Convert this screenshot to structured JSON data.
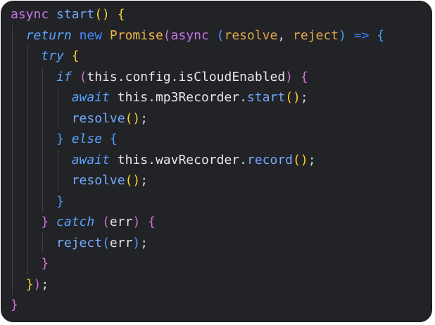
{
  "editor": {
    "lines": [
      {
        "indent": 0,
        "tokens": [
          {
            "t": "async",
            "c": "kw-purple"
          },
          {
            "t": " ",
            "c": "text"
          },
          {
            "t": "start",
            "c": "fn"
          },
          {
            "t": "()",
            "c": "brace-y"
          },
          {
            "t": " ",
            "c": "text"
          },
          {
            "t": "{",
            "c": "brace-y"
          }
        ]
      },
      {
        "indent": 1,
        "tokens": [
          {
            "t": "return",
            "c": "kw-italic"
          },
          {
            "t": " ",
            "c": "text"
          },
          {
            "t": "new",
            "c": "kw-blue"
          },
          {
            "t": " ",
            "c": "text"
          },
          {
            "t": "Promise",
            "c": "class"
          },
          {
            "t": "(",
            "c": "brace-p"
          },
          {
            "t": "async",
            "c": "kw-purple"
          },
          {
            "t": " ",
            "c": "text"
          },
          {
            "t": "(",
            "c": "brace-b"
          },
          {
            "t": "resolve",
            "c": "param"
          },
          {
            "t": ", ",
            "c": "punct"
          },
          {
            "t": "reject",
            "c": "param"
          },
          {
            "t": ")",
            "c": "brace-b"
          },
          {
            "t": " ",
            "c": "text"
          },
          {
            "t": "=>",
            "c": "arrow"
          },
          {
            "t": " ",
            "c": "text"
          },
          {
            "t": "{",
            "c": "brace-b"
          }
        ]
      },
      {
        "indent": 2,
        "tokens": [
          {
            "t": "try",
            "c": "kw-italic"
          },
          {
            "t": " ",
            "c": "text"
          },
          {
            "t": "{",
            "c": "brace-y"
          }
        ]
      },
      {
        "indent": 3,
        "tokens": [
          {
            "t": "if",
            "c": "kw-italic"
          },
          {
            "t": " ",
            "c": "text"
          },
          {
            "t": "(",
            "c": "brace-p"
          },
          {
            "t": "this",
            "c": "text"
          },
          {
            "t": ".",
            "c": "punct"
          },
          {
            "t": "config",
            "c": "text"
          },
          {
            "t": ".",
            "c": "punct"
          },
          {
            "t": "isCloudEnabled",
            "c": "text"
          },
          {
            "t": ")",
            "c": "brace-p"
          },
          {
            "t": " ",
            "c": "text"
          },
          {
            "t": "{",
            "c": "brace-p"
          }
        ]
      },
      {
        "indent": 4,
        "tokens": [
          {
            "t": "await",
            "c": "kw-italic"
          },
          {
            "t": " ",
            "c": "text"
          },
          {
            "t": "this",
            "c": "text"
          },
          {
            "t": ".",
            "c": "punct"
          },
          {
            "t": "mp3Recorder",
            "c": "text"
          },
          {
            "t": ".",
            "c": "punct"
          },
          {
            "t": "start",
            "c": "fn"
          },
          {
            "t": "()",
            "c": "brace-y"
          },
          {
            "t": ";",
            "c": "punct"
          }
        ]
      },
      {
        "indent": 4,
        "tokens": [
          {
            "t": "resolve",
            "c": "fn"
          },
          {
            "t": "()",
            "c": "brace-y"
          },
          {
            "t": ";",
            "c": "punct"
          }
        ]
      },
      {
        "indent": 3,
        "tokens": [
          {
            "t": "}",
            "c": "brace-b"
          },
          {
            "t": " ",
            "c": "text"
          },
          {
            "t": "else",
            "c": "kw-italic"
          },
          {
            "t": " ",
            "c": "text"
          },
          {
            "t": "{",
            "c": "brace-b"
          }
        ]
      },
      {
        "indent": 4,
        "tokens": [
          {
            "t": "await",
            "c": "kw-italic"
          },
          {
            "t": " ",
            "c": "text"
          },
          {
            "t": "this",
            "c": "text"
          },
          {
            "t": ".",
            "c": "punct"
          },
          {
            "t": "wavRecorder",
            "c": "text"
          },
          {
            "t": ".",
            "c": "punct"
          },
          {
            "t": "record",
            "c": "fn"
          },
          {
            "t": "()",
            "c": "brace-y"
          },
          {
            "t": ";",
            "c": "punct"
          }
        ]
      },
      {
        "indent": 4,
        "tokens": [
          {
            "t": "resolve",
            "c": "fn"
          },
          {
            "t": "()",
            "c": "brace-y"
          },
          {
            "t": ";",
            "c": "punct"
          }
        ]
      },
      {
        "indent": 3,
        "tokens": [
          {
            "t": "}",
            "c": "brace-b"
          }
        ]
      },
      {
        "indent": 2,
        "tokens": [
          {
            "t": "}",
            "c": "brace-p"
          },
          {
            "t": " ",
            "c": "text"
          },
          {
            "t": "catch",
            "c": "kw-italic"
          },
          {
            "t": " ",
            "c": "text"
          },
          {
            "t": "(",
            "c": "brace-p"
          },
          {
            "t": "err",
            "c": "text"
          },
          {
            "t": ")",
            "c": "brace-p"
          },
          {
            "t": " ",
            "c": "text"
          },
          {
            "t": "{",
            "c": "brace-p"
          }
        ]
      },
      {
        "indent": 3,
        "tokens": [
          {
            "t": "reject",
            "c": "fn"
          },
          {
            "t": "(",
            "c": "brace-b"
          },
          {
            "t": "err",
            "c": "text"
          },
          {
            "t": ")",
            "c": "brace-b"
          },
          {
            "t": ";",
            "c": "punct"
          }
        ]
      },
      {
        "indent": 2,
        "tokens": [
          {
            "t": "}",
            "c": "brace-p"
          }
        ]
      },
      {
        "indent": 1,
        "tokens": [
          {
            "t": "}",
            "c": "brace-y"
          },
          {
            "t": ")",
            "c": "brace-p"
          },
          {
            "t": ";",
            "c": "punct"
          }
        ]
      },
      {
        "indent": 0,
        "tokens": [
          {
            "t": "}",
            "c": "brace-p"
          }
        ]
      }
    ]
  },
  "colors": {
    "background": "#222326",
    "indent_guide": "#3f4147"
  }
}
